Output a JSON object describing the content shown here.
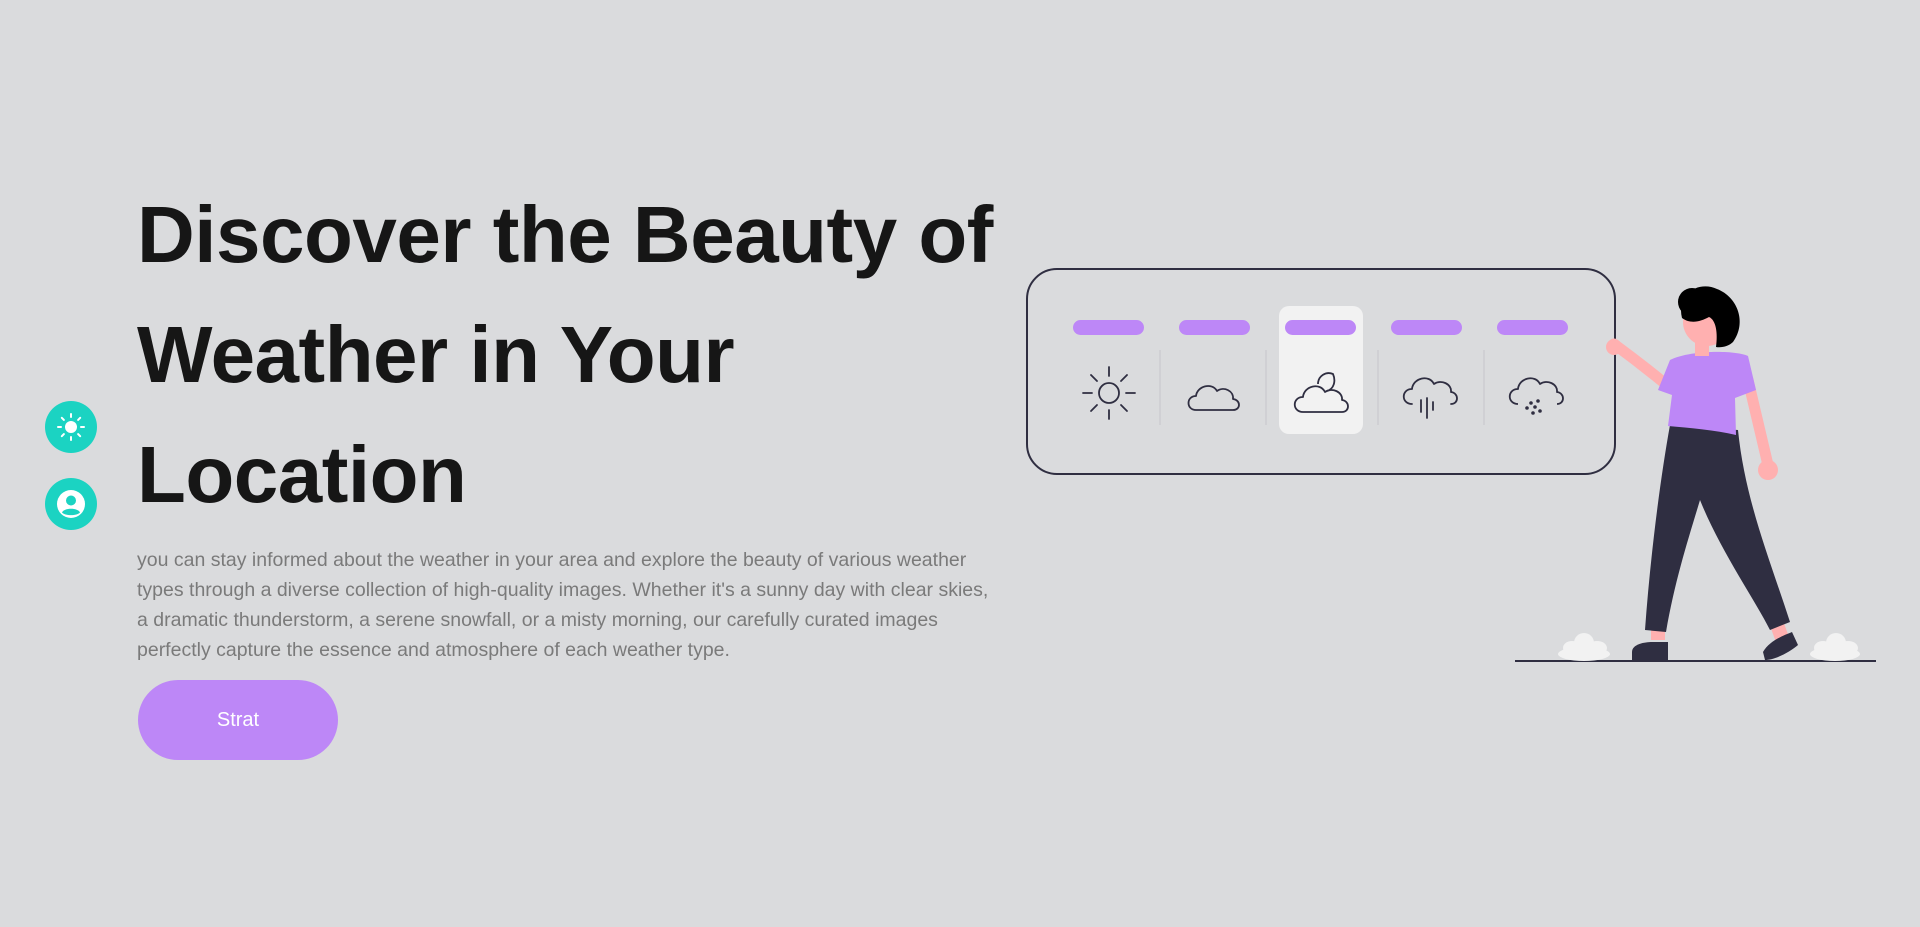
{
  "side_buttons": [
    {
      "icon": "sun-icon"
    },
    {
      "icon": "user-icon"
    }
  ],
  "hero": {
    "title": "Discover the Beauty of Weather in Your Location",
    "description": "you can stay informed about the weather in your area and explore the beauty of various weather types through a diverse collection of high-quality images. Whether it's a sunny day with clear skies, a dramatic thunderstorm, a serene snowfall, or a misty morning, our carefully curated images perfectly capture the essence and atmosphere of each weather type.",
    "cta_label": "Strat"
  },
  "illustration": {
    "weather_icons": [
      "sun-icon",
      "cloud-icon",
      "cloud-moon-icon",
      "rain-cloud-icon",
      "snow-cloud-icon"
    ],
    "selected_index": 2
  },
  "colors": {
    "background": "#dadbdd",
    "accent_teal": "#1bd3c2",
    "accent_purple": "#bd87f7",
    "title": "#161616",
    "body_text": "#7a7a7a",
    "figure_dark": "#2f2e41",
    "skin": "#ffb0b0"
  }
}
